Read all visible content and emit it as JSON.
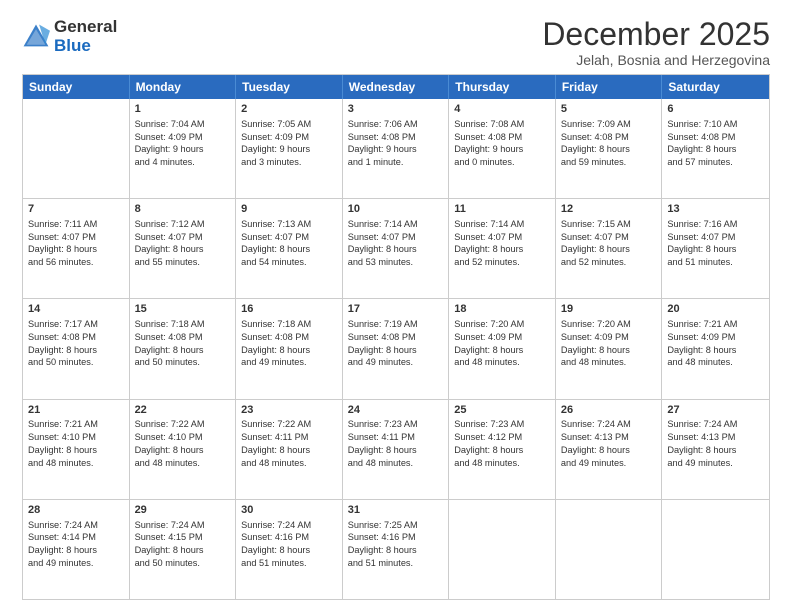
{
  "logo": {
    "general": "General",
    "blue": "Blue"
  },
  "title": "December 2025",
  "subtitle": "Jelah, Bosnia and Herzegovina",
  "header_days": [
    "Sunday",
    "Monday",
    "Tuesday",
    "Wednesday",
    "Thursday",
    "Friday",
    "Saturday"
  ],
  "rows": [
    [
      {
        "day": "",
        "info": ""
      },
      {
        "day": "1",
        "info": "Sunrise: 7:04 AM\nSunset: 4:09 PM\nDaylight: 9 hours\nand 4 minutes."
      },
      {
        "day": "2",
        "info": "Sunrise: 7:05 AM\nSunset: 4:09 PM\nDaylight: 9 hours\nand 3 minutes."
      },
      {
        "day": "3",
        "info": "Sunrise: 7:06 AM\nSunset: 4:08 PM\nDaylight: 9 hours\nand 1 minute."
      },
      {
        "day": "4",
        "info": "Sunrise: 7:08 AM\nSunset: 4:08 PM\nDaylight: 9 hours\nand 0 minutes."
      },
      {
        "day": "5",
        "info": "Sunrise: 7:09 AM\nSunset: 4:08 PM\nDaylight: 8 hours\nand 59 minutes."
      },
      {
        "day": "6",
        "info": "Sunrise: 7:10 AM\nSunset: 4:08 PM\nDaylight: 8 hours\nand 57 minutes."
      }
    ],
    [
      {
        "day": "7",
        "info": "Sunrise: 7:11 AM\nSunset: 4:07 PM\nDaylight: 8 hours\nand 56 minutes."
      },
      {
        "day": "8",
        "info": "Sunrise: 7:12 AM\nSunset: 4:07 PM\nDaylight: 8 hours\nand 55 minutes."
      },
      {
        "day": "9",
        "info": "Sunrise: 7:13 AM\nSunset: 4:07 PM\nDaylight: 8 hours\nand 54 minutes."
      },
      {
        "day": "10",
        "info": "Sunrise: 7:14 AM\nSunset: 4:07 PM\nDaylight: 8 hours\nand 53 minutes."
      },
      {
        "day": "11",
        "info": "Sunrise: 7:14 AM\nSunset: 4:07 PM\nDaylight: 8 hours\nand 52 minutes."
      },
      {
        "day": "12",
        "info": "Sunrise: 7:15 AM\nSunset: 4:07 PM\nDaylight: 8 hours\nand 52 minutes."
      },
      {
        "day": "13",
        "info": "Sunrise: 7:16 AM\nSunset: 4:07 PM\nDaylight: 8 hours\nand 51 minutes."
      }
    ],
    [
      {
        "day": "14",
        "info": "Sunrise: 7:17 AM\nSunset: 4:08 PM\nDaylight: 8 hours\nand 50 minutes."
      },
      {
        "day": "15",
        "info": "Sunrise: 7:18 AM\nSunset: 4:08 PM\nDaylight: 8 hours\nand 50 minutes."
      },
      {
        "day": "16",
        "info": "Sunrise: 7:18 AM\nSunset: 4:08 PM\nDaylight: 8 hours\nand 49 minutes."
      },
      {
        "day": "17",
        "info": "Sunrise: 7:19 AM\nSunset: 4:08 PM\nDaylight: 8 hours\nand 49 minutes."
      },
      {
        "day": "18",
        "info": "Sunrise: 7:20 AM\nSunset: 4:09 PM\nDaylight: 8 hours\nand 48 minutes."
      },
      {
        "day": "19",
        "info": "Sunrise: 7:20 AM\nSunset: 4:09 PM\nDaylight: 8 hours\nand 48 minutes."
      },
      {
        "day": "20",
        "info": "Sunrise: 7:21 AM\nSunset: 4:09 PM\nDaylight: 8 hours\nand 48 minutes."
      }
    ],
    [
      {
        "day": "21",
        "info": "Sunrise: 7:21 AM\nSunset: 4:10 PM\nDaylight: 8 hours\nand 48 minutes."
      },
      {
        "day": "22",
        "info": "Sunrise: 7:22 AM\nSunset: 4:10 PM\nDaylight: 8 hours\nand 48 minutes."
      },
      {
        "day": "23",
        "info": "Sunrise: 7:22 AM\nSunset: 4:11 PM\nDaylight: 8 hours\nand 48 minutes."
      },
      {
        "day": "24",
        "info": "Sunrise: 7:23 AM\nSunset: 4:11 PM\nDaylight: 8 hours\nand 48 minutes."
      },
      {
        "day": "25",
        "info": "Sunrise: 7:23 AM\nSunset: 4:12 PM\nDaylight: 8 hours\nand 48 minutes."
      },
      {
        "day": "26",
        "info": "Sunrise: 7:24 AM\nSunset: 4:13 PM\nDaylight: 8 hours\nand 49 minutes."
      },
      {
        "day": "27",
        "info": "Sunrise: 7:24 AM\nSunset: 4:13 PM\nDaylight: 8 hours\nand 49 minutes."
      }
    ],
    [
      {
        "day": "28",
        "info": "Sunrise: 7:24 AM\nSunset: 4:14 PM\nDaylight: 8 hours\nand 49 minutes."
      },
      {
        "day": "29",
        "info": "Sunrise: 7:24 AM\nSunset: 4:15 PM\nDaylight: 8 hours\nand 50 minutes."
      },
      {
        "day": "30",
        "info": "Sunrise: 7:24 AM\nSunset: 4:16 PM\nDaylight: 8 hours\nand 51 minutes."
      },
      {
        "day": "31",
        "info": "Sunrise: 7:25 AM\nSunset: 4:16 PM\nDaylight: 8 hours\nand 51 minutes."
      },
      {
        "day": "",
        "info": ""
      },
      {
        "day": "",
        "info": ""
      },
      {
        "day": "",
        "info": ""
      }
    ]
  ]
}
